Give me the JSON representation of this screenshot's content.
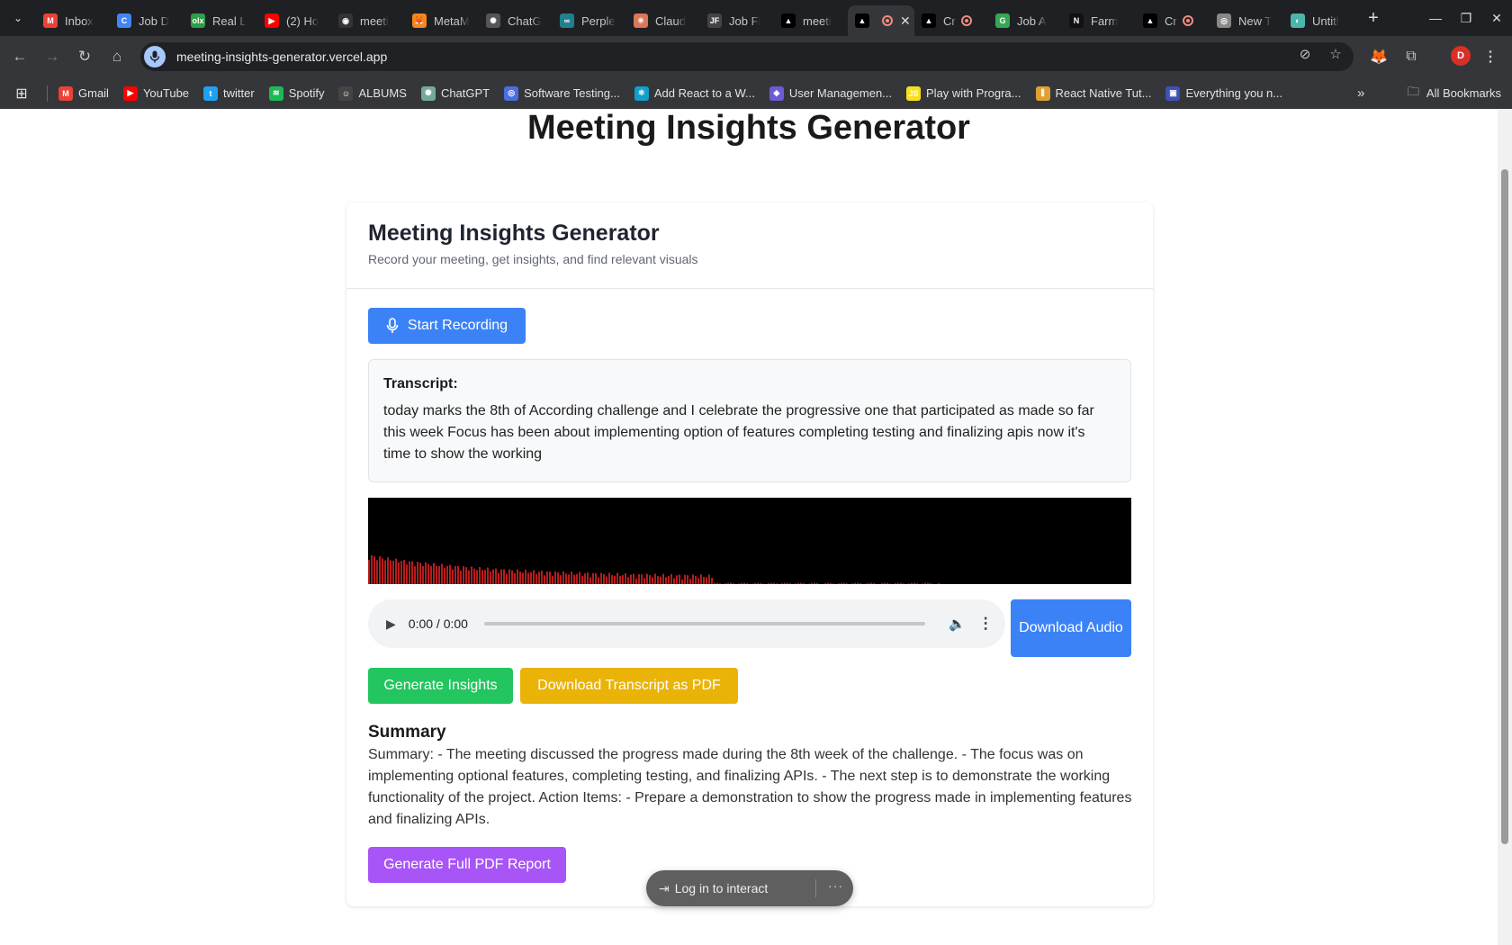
{
  "browser": {
    "tabs": [
      {
        "title": "Inbox",
        "favicon": "gmail-icon",
        "color": "#ea4335",
        "glyph": "M"
      },
      {
        "title": "Job D",
        "favicon": "c-icon",
        "color": "#4285f4",
        "glyph": "C"
      },
      {
        "title": "Real L",
        "favicon": "olx-icon",
        "color": "#2e9e48",
        "glyph": "olx"
      },
      {
        "title": "(2) Ho",
        "favicon": "youtube-icon",
        "color": "#ff0000",
        "glyph": "▶"
      },
      {
        "title": "meeti",
        "favicon": "github-icon",
        "color": "#333333",
        "glyph": "◉"
      },
      {
        "title": "MetaM",
        "favicon": "metamask-icon",
        "color": "#f6851b",
        "glyph": "🦊"
      },
      {
        "title": "ChatG",
        "favicon": "chatgpt-icon",
        "color": "#555555",
        "glyph": "✺"
      },
      {
        "title": "Perple",
        "favicon": "perplexity-icon",
        "color": "#20808d",
        "glyph": "∞"
      },
      {
        "title": "Claud",
        "favicon": "claude-icon",
        "color": "#d97757",
        "glyph": "✳"
      },
      {
        "title": "Job Fi",
        "favicon": "jf-icon",
        "color": "#444444",
        "glyph": "JF"
      },
      {
        "title": "meeti",
        "favicon": "vercel-icon",
        "color": "#000000",
        "glyph": "▲"
      },
      {
        "title": "",
        "favicon": "vercel-icon",
        "color": "#000000",
        "glyph": "▲",
        "active": true,
        "recording": true
      },
      {
        "title": "Cr",
        "favicon": "vercel-icon",
        "color": "#000000",
        "glyph": "▲",
        "recording": true
      },
      {
        "title": "Job A",
        "favicon": "g-icon",
        "color": "#34a853",
        "glyph": "G"
      },
      {
        "title": "Farm",
        "favicon": "nest-icon",
        "color": "#111111",
        "glyph": "N"
      },
      {
        "title": "Cr",
        "favicon": "vercel-icon",
        "color": "#000000",
        "glyph": "▲",
        "recording": true
      },
      {
        "title": "New T",
        "favicon": "chrome-icon",
        "color": "#888888",
        "glyph": "◎"
      },
      {
        "title": "Untitl",
        "favicon": "globe-icon",
        "color": "#4db6ac",
        "glyph": "◐"
      }
    ],
    "url": "meeting-insights-generator.vercel.app",
    "profile_initial": "D",
    "bookmarks": [
      {
        "label": "Gmail",
        "icon": "gmail-icon",
        "color": "#ea4335",
        "glyph": "M"
      },
      {
        "label": "YouTube",
        "icon": "youtube-icon",
        "color": "#ff0000",
        "glyph": "▶"
      },
      {
        "label": "twitter",
        "icon": "twitter-icon",
        "color": "#1da1f2",
        "glyph": "t"
      },
      {
        "label": "Spotify",
        "icon": "spotify-icon",
        "color": "#1db954",
        "glyph": "≋"
      },
      {
        "label": "ALBUMS",
        "icon": "person-icon",
        "color": "#444444",
        "glyph": "☺"
      },
      {
        "label": "ChatGPT",
        "icon": "chatgpt-icon",
        "color": "#74aa9c",
        "glyph": "✺"
      },
      {
        "label": "Software Testing...",
        "icon": "globe-icon",
        "color": "#4a6ee0",
        "glyph": "◎"
      },
      {
        "label": "Add React to a W...",
        "icon": "react-icon",
        "color": "#149eca",
        "glyph": "⚛"
      },
      {
        "label": "User Managemen...",
        "icon": "app-icon",
        "color": "#6b5bd6",
        "glyph": "◆"
      },
      {
        "label": "Play with Progra...",
        "icon": "play-icon",
        "color": "#f7df1e",
        "glyph": "JS"
      },
      {
        "label": "React Native Tut...",
        "icon": "bar-icon",
        "color": "#e0a030",
        "glyph": "⫼"
      },
      {
        "label": "Everything you n...",
        "icon": "book-icon",
        "color": "#3f51b5",
        "glyph": "▣"
      }
    ],
    "all_bookmarks_label": "All Bookmarks"
  },
  "page": {
    "title": "Meeting Insights Generator",
    "card": {
      "title": "Meeting Insights Generator",
      "subtitle": "Record your meeting, get insights, and find relevant visuals"
    },
    "start_recording_label": "Start Recording",
    "transcript_label": "Transcript:",
    "transcript_text": "today marks the 8th of According challenge and I celebrate the progressive one that participated as made so far this week Focus has been about implementing option of features completing testing and finalizing apis now it's time to show the working",
    "audio": {
      "time": "0:00 / 0:00"
    },
    "download_audio_label": "Download Audio",
    "generate_insights_label": "Generate Insights",
    "download_transcript_label": "Download Transcript as PDF",
    "summary_heading": "Summary",
    "summary_text": "Summary: - The meeting discussed the progress made during the 8th week of the challenge. - The focus was on implementing optional features, completing testing, and finalizing APIs. - The next step is to demonstrate the working functionality of the project. Action Items: - Prepare a demonstration to show the progress made in implementing features and finalizing APIs.",
    "full_report_label": "Generate Full PDF Report",
    "login_pill_label": "Log in to interact",
    "colors": {
      "primary": "#3b82f6",
      "success": "#22c55e",
      "warning": "#eab308",
      "accent": "#a855f7",
      "waveform": "#b91c1c"
    }
  }
}
